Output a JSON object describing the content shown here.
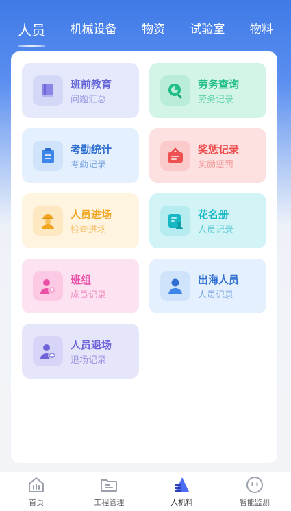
{
  "tabs": [
    {
      "label": "人员",
      "active": true
    },
    {
      "label": "机械设备",
      "active": false
    },
    {
      "label": "物资",
      "active": false
    },
    {
      "label": "试验室",
      "active": false
    },
    {
      "label": "物料",
      "active": false
    }
  ],
  "cards": [
    {
      "title": "班前教育",
      "subtitle": "问题汇总",
      "bg": "#e6e9fb",
      "icon_bg": "#d4d8f7",
      "color": "#6466d8",
      "sub_color": "#9a9ce0",
      "icon": "book-icon"
    },
    {
      "title": "劳务查询",
      "subtitle": "劳务记录",
      "bg": "#d3f5e7",
      "icon_bg": "#b9edd8",
      "color": "#1fbf85",
      "sub_color": "#5fd3a7",
      "icon": "search-icon"
    },
    {
      "title": "考勤统计",
      "subtitle": "考勤记录",
      "bg": "#e4f0fd",
      "icon_bg": "#cfe4fb",
      "color": "#2f6fd1",
      "sub_color": "#7fa7e4",
      "icon": "clipboard-icon"
    },
    {
      "title": "奖惩记录",
      "subtitle": "奖励惩罚",
      "bg": "#fde0e0",
      "icon_bg": "#fbcaca",
      "color": "#ec4b4b",
      "sub_color": "#f19a9a",
      "icon": "briefcase-icon"
    },
    {
      "title": "人员进场",
      "subtitle": "检查进场",
      "bg": "#fff4df",
      "icon_bg": "#fde8c2",
      "color": "#f0a41f",
      "sub_color": "#f3c069",
      "icon": "worker-icon"
    },
    {
      "title": "花名册",
      "subtitle": "人员记录",
      "bg": "#d2f4f6",
      "icon_bg": "#b4ecef",
      "color": "#17b7c4",
      "sub_color": "#5fcbd3",
      "icon": "roster-icon"
    },
    {
      "title": "班组",
      "subtitle": "成员记录",
      "bg": "#fde2f1",
      "icon_bg": "#fbc9e4",
      "color": "#ea4fa6",
      "sub_color": "#f18cc3",
      "icon": "team-icon"
    },
    {
      "title": "出海人员",
      "subtitle": "人员记录",
      "bg": "#e4f0fd",
      "icon_bg": "#cfe4fb",
      "color": "#2f6fd1",
      "sub_color": "#7fa7e4",
      "icon": "person-icon"
    },
    {
      "title": "人员退场",
      "subtitle": "退场记录",
      "bg": "#e6e6fb",
      "icon_bg": "#d6d5f7",
      "color": "#6f63d9",
      "sub_color": "#9b93e2",
      "icon": "person-exit-icon"
    }
  ],
  "nav": [
    {
      "label": "首页",
      "icon": "home-icon",
      "active": false
    },
    {
      "label": "工程管理",
      "icon": "folder-icon",
      "active": false
    },
    {
      "label": "人机料",
      "icon": "resources-icon",
      "active": true
    },
    {
      "label": "智能监测",
      "icon": "monitor-face-icon",
      "active": false
    }
  ],
  "colors": {
    "primary": "#3f7ae6",
    "nav_active": "#4a6cf0",
    "nav_inactive": "#9aa1ad"
  }
}
